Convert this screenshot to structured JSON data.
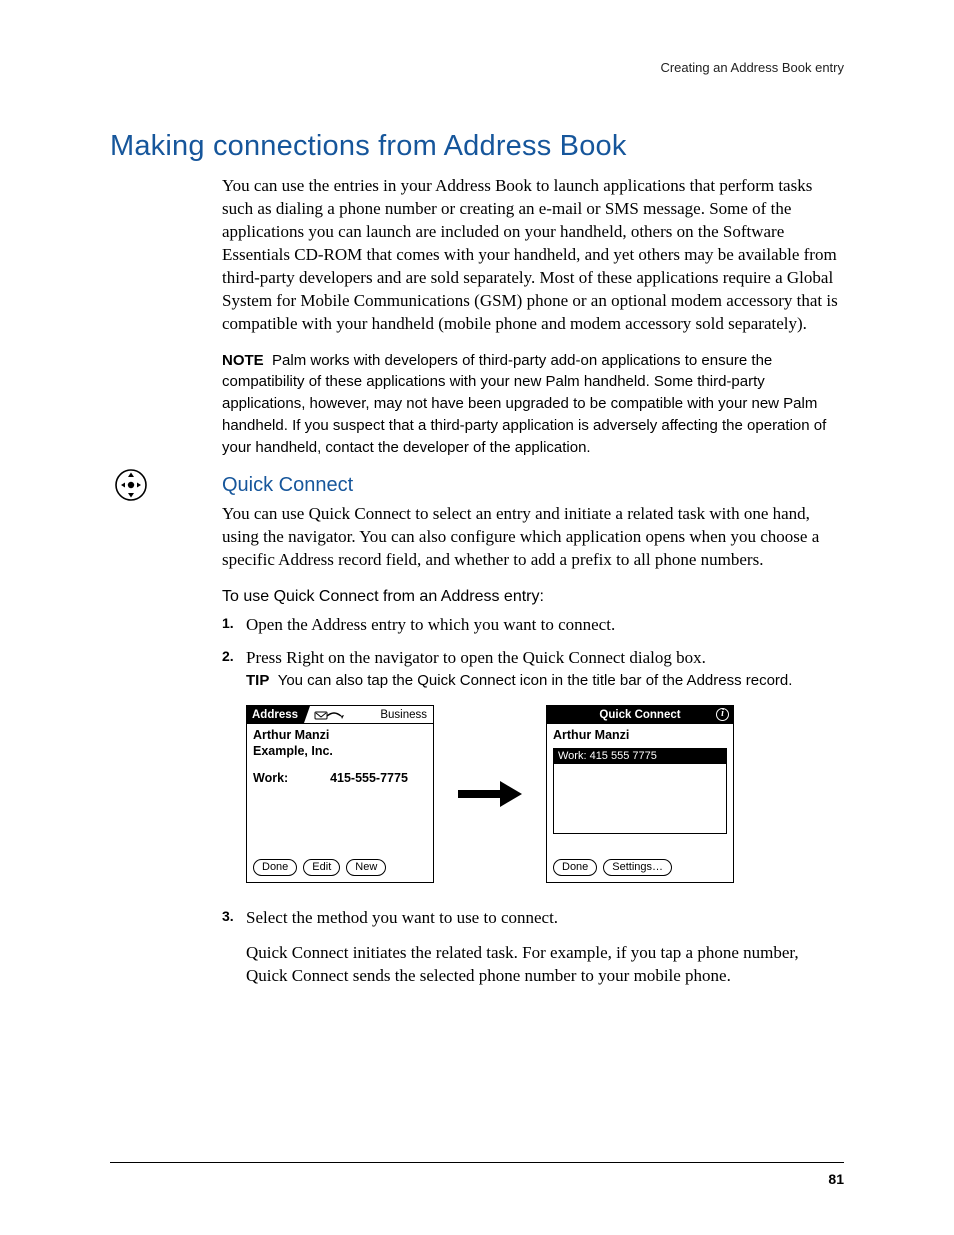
{
  "running_head": "Creating an Address Book entry",
  "section_title": "Making connections from Address Book",
  "intro_paragraph": "You can use the entries in your Address Book to launch applications that perform tasks such as dialing a phone number or creating an e-mail or SMS message. Some of the applications you can launch are included on your handheld, others on the Software Essentials CD-ROM that comes with your handheld, and yet others may be available from third-party developers and are sold separately. Most of these applications require a Global System for Mobile Communications (GSM) phone or an optional modem accessory that is compatible with your handheld (mobile phone and modem accessory sold separately).",
  "note_label": "NOTE",
  "note_body": "Palm works with developers of third-party add-on applications to ensure the compatibility of these applications with your new Palm handheld. Some third-party applications, however, may not have been upgraded to be compatible with your new Palm handheld. If you suspect that a third-party application is adversely affecting the operation of your handheld, contact the developer of the application.",
  "quick_connect": {
    "heading": "Quick Connect",
    "paragraph": "You can use Quick Connect to select an entry and initiate a related task with one hand, using the navigator. You can also configure which application opens when you choose a specific Address record field, and whether to add a prefix to all phone numbers.",
    "howto_heading": "To use Quick Connect from an Address entry:",
    "steps": {
      "s1": "Open the Address entry to which you want to connect.",
      "s2": "Press Right on the navigator to open the Quick Connect dialog box.",
      "s3": "Select the method you want to use to connect."
    },
    "tip_label": "TIP",
    "tip_body": "You can also tap the Quick Connect icon in the title bar of the Address record.",
    "result_paragraph": "Quick Connect initiates the related task. For example, if you tap a phone number, Quick Connect sends the selected phone number to your mobile phone."
  },
  "screenshots": {
    "address": {
      "title": "Address",
      "category": "Business",
      "name": "Arthur Manzi",
      "company": "Example, Inc.",
      "field_label": "Work:",
      "field_value": "415-555-7775",
      "buttons": {
        "done": "Done",
        "edit": "Edit",
        "new": "New"
      }
    },
    "quick_connect_dialog": {
      "title": "Quick Connect",
      "name": "Arthur Manzi",
      "selected_item": "Work: 415 555 7775",
      "buttons": {
        "done": "Done",
        "settings": "Settings…"
      }
    }
  },
  "page_number": "81"
}
